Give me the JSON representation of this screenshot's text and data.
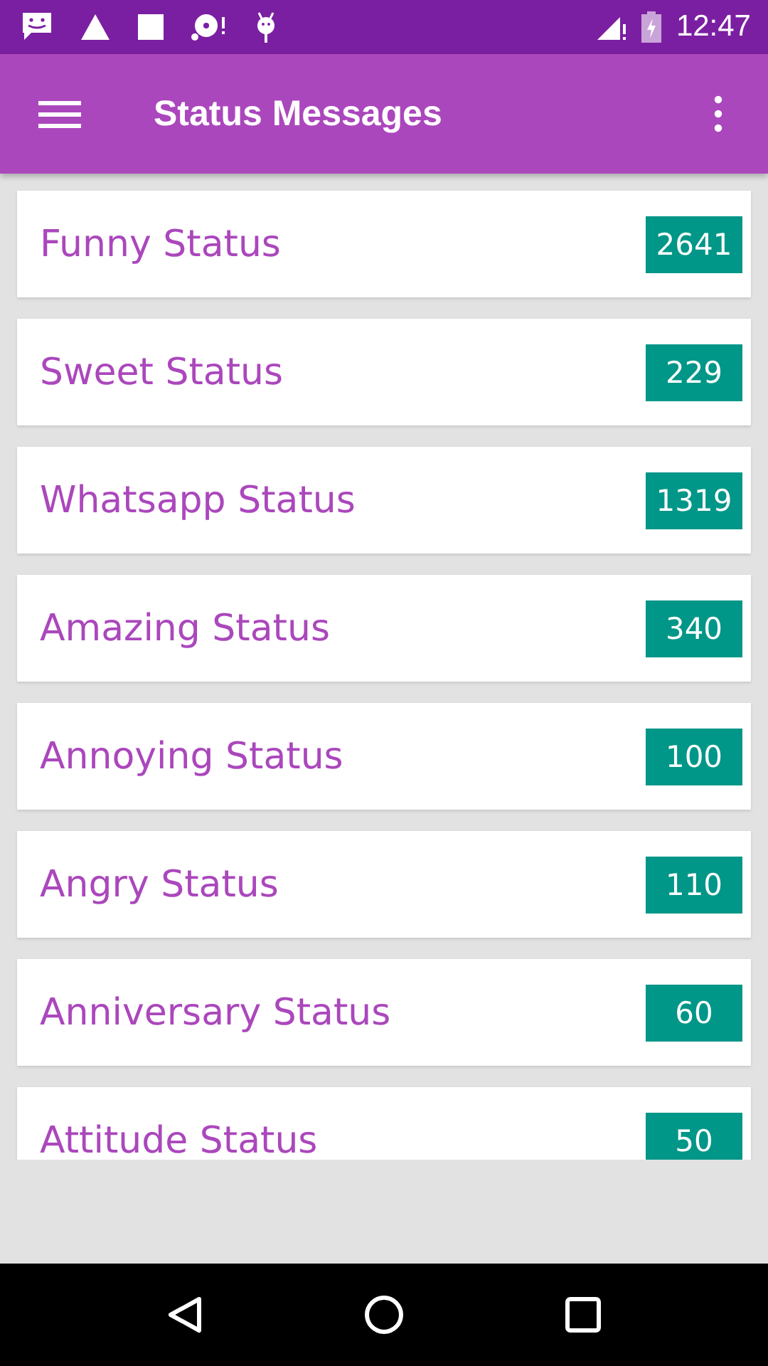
{
  "status_bar": {
    "time": "12:47"
  },
  "toolbar": {
    "title": "Status Messages"
  },
  "categories": [
    {
      "name": "Funny Status",
      "count": "2641"
    },
    {
      "name": "Sweet Status",
      "count": "229"
    },
    {
      "name": "Whatsapp Status",
      "count": "1319"
    },
    {
      "name": "Amazing Status",
      "count": "340"
    },
    {
      "name": "Annoying Status",
      "count": "100"
    },
    {
      "name": "Angry Status",
      "count": "110"
    },
    {
      "name": "Anniversary Status",
      "count": "60"
    },
    {
      "name": "Attitude Status",
      "count": "50"
    }
  ]
}
